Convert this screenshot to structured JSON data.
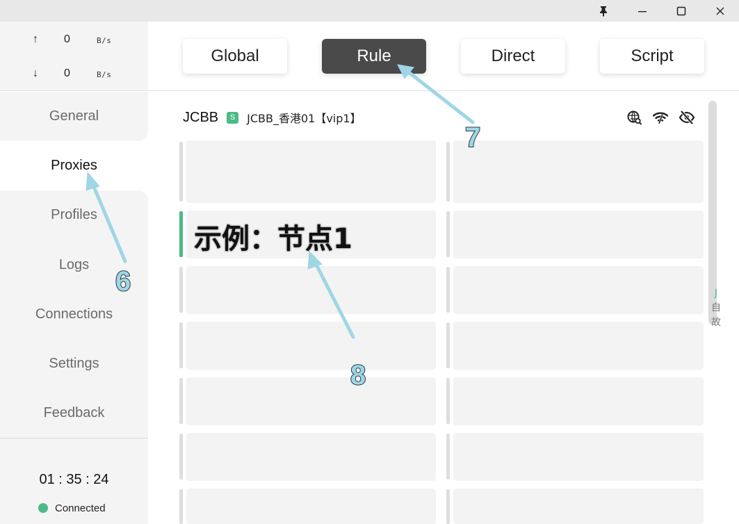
{
  "titlebar": {
    "pin_icon": "pin-icon",
    "minimize_icon": "minimize-icon",
    "maximize_icon": "maximize-icon",
    "close_icon": "close-icon"
  },
  "sidebar": {
    "traffic": {
      "upload": {
        "arrow": "↑",
        "value": "0",
        "unit": "B/s"
      },
      "download": {
        "arrow": "↓",
        "value": "0",
        "unit": "B/s"
      }
    },
    "nav": [
      {
        "label": "General"
      },
      {
        "label": "Proxies"
      },
      {
        "label": "Profiles"
      },
      {
        "label": "Logs"
      },
      {
        "label": "Connections"
      },
      {
        "label": "Settings"
      },
      {
        "label": "Feedback"
      }
    ],
    "active_nav": "Proxies",
    "clock": "01 : 35 : 24",
    "status": "Connected"
  },
  "modes": {
    "items": [
      {
        "label": "Global"
      },
      {
        "label": "Rule"
      },
      {
        "label": "Direct"
      },
      {
        "label": "Script"
      }
    ],
    "active": "Rule"
  },
  "proxy_group": {
    "name": "JCBB",
    "badge": "S",
    "selected": "JCBB_香港01【vip1】",
    "icons": [
      "latency-test-icon",
      "wifi-icon",
      "hide-icon"
    ]
  },
  "proxy_list": {
    "highlighted_label": "示例：节点1"
  },
  "az_index": {
    "letter": "J",
    "chars": [
      "自",
      "故"
    ]
  },
  "annotations": [
    "6",
    "7",
    "8"
  ],
  "colors": {
    "accent": "#4cba86",
    "active_mode_bg": "#4a4a4a",
    "sidebar_bg": "#f4f4f4",
    "card_bg": "#f3f3f3",
    "annotation": "#9fd6e6"
  }
}
